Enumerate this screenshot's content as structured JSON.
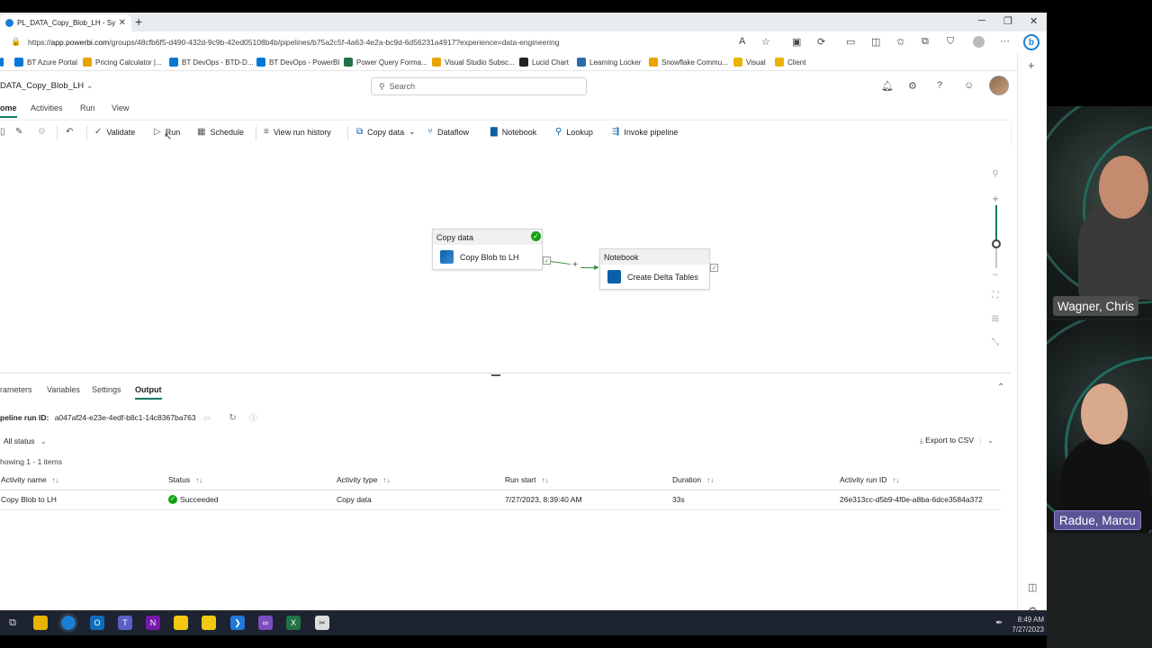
{
  "browser": {
    "tab_title": "PL_DATA_Copy_Blob_LH - Synapse",
    "new_tab": "+",
    "url_prefix": "https://",
    "url_host": "app.powerbi.com",
    "url_path": "/groups/48cfb6f5-d490-432d-9c9b-42ed05108b4b/pipelines/b75a2c5f-4a63-4e2a-bc9d-6d56231a4917?experience=data-engineering"
  },
  "bookmarks": [
    {
      "label": "BT Azure Portal",
      "color": "#0078d4"
    },
    {
      "label": "Pricing Calculator |...",
      "color": "#e8a400"
    },
    {
      "label": "BT DevOps - BTD-D...",
      "color": "#0078d4"
    },
    {
      "label": "BT DevOps - PowerBI",
      "color": "#0078d4"
    },
    {
      "label": "Power Query Forma...",
      "color": "#217346"
    },
    {
      "label": "Visual Studio Subsc...",
      "color": "#e8a400"
    },
    {
      "label": "Lucid Chart",
      "color": "#222222"
    },
    {
      "label": "Learning Locker",
      "color": "#2b6cb0"
    },
    {
      "label": "Snowflake Commu...",
      "color": "#e8a400"
    },
    {
      "label": "Visual",
      "color": "#e8b400"
    },
    {
      "label": "Client",
      "color": "#e8b400"
    }
  ],
  "app": {
    "pipeline_name": "DATA_Copy_Blob_LH",
    "search_placeholder": "Search"
  },
  "menu_tabs": [
    "ome",
    "Activities",
    "Run",
    "View"
  ],
  "toolbar": {
    "validate": "Validate",
    "run": "Run",
    "schedule": "Schedule",
    "view_run_history": "View run history",
    "copy_data": "Copy data",
    "dataflow": "Dataflow",
    "notebook": "Notebook",
    "lookup": "Lookup",
    "invoke_pipeline": "Invoke pipeline"
  },
  "canvas": {
    "activity1": {
      "type": "Copy data",
      "name": "Copy Blob to LH"
    },
    "activity2": {
      "type": "Notebook",
      "name": "Create Delta Tables"
    }
  },
  "panel": {
    "tabs": [
      "rameters",
      "Variables",
      "Settings",
      "Output"
    ],
    "run_id_label": "peline run ID:",
    "run_id_value": "a047af24-e23e-4edf-b8c1-14c8367ba763",
    "status_filter": "All status",
    "export": "Export to CSV",
    "showing": "howing 1 - 1 items",
    "columns": [
      "Activity name",
      "Status",
      "Activity type",
      "Run start",
      "Duration",
      "Activity run ID"
    ],
    "rows": [
      {
        "name": "Copy Blob to LH",
        "status": "Succeeded",
        "type": "Copy data",
        "run_start": "7/27/2023, 8:39:40 AM",
        "duration": "33s",
        "run_id": "26e313cc-d5b9-4f0e-a8ba-6dce3584a372"
      }
    ]
  },
  "taskbar": {
    "time": "8:49 AM",
    "date": "7/27/2023"
  },
  "participants": [
    {
      "name": "Wagner, Chris"
    },
    {
      "name": "Radue, Marcu"
    }
  ],
  "colors": {
    "accent": "#117865",
    "success": "#13a10e",
    "nameplate1": "#4d4d4d",
    "nameplate2": "#5b5497"
  }
}
